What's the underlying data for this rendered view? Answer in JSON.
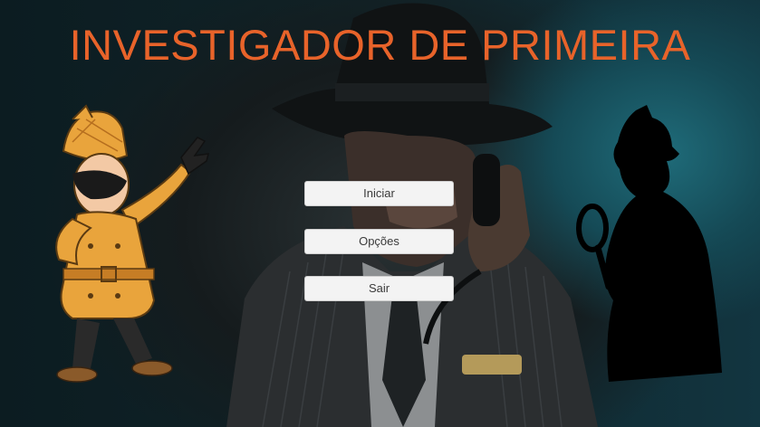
{
  "title": "INVESTIGADOR DE PRIMEIRA",
  "menu": {
    "start_label": "Iniciar",
    "options_label": "Opções",
    "exit_label": "Sair"
  },
  "colors": {
    "title": "#e8632a",
    "button_bg": "#f3f3f3",
    "button_text": "#3a3a3a",
    "coat": "#e9a43c",
    "silhouette": "#000000"
  },
  "art": {
    "left_character": "cartoon-detective-dab",
    "center_background": "noir-detective-on-phone",
    "right_silhouette": "detective-magnifier-silhouette"
  }
}
